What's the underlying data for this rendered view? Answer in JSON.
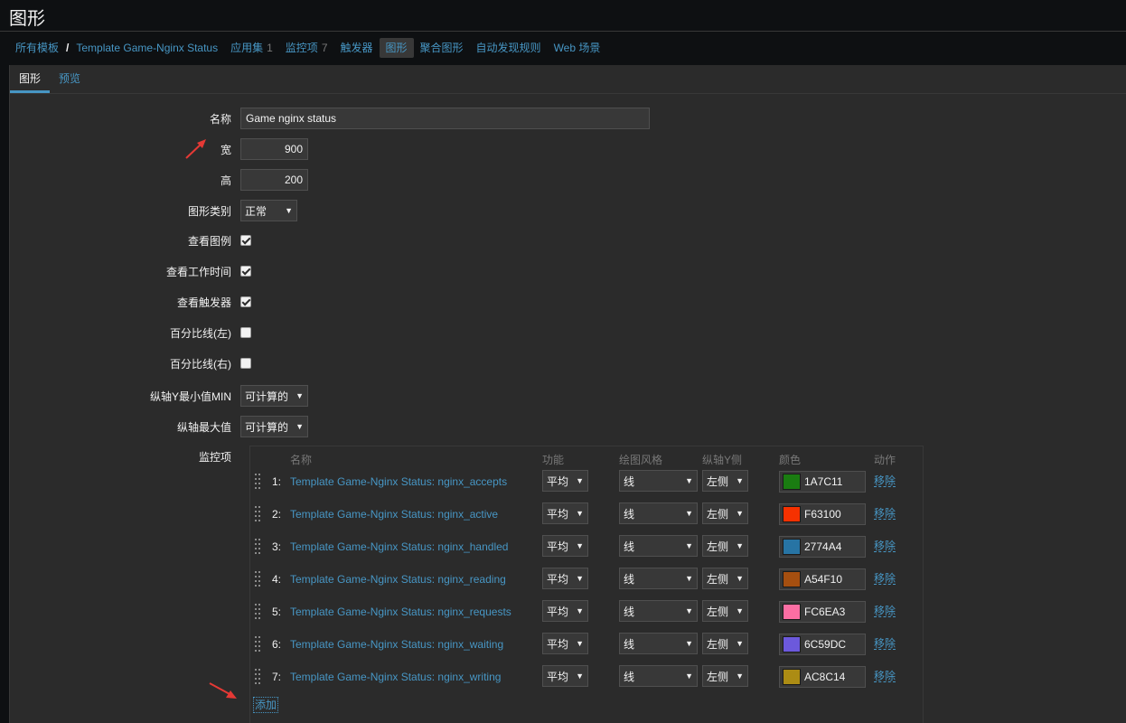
{
  "page": {
    "title": "图形"
  },
  "breadcrumbs": [
    {
      "label": "所有模板",
      "count": ""
    },
    {
      "label": "Template Game-Nginx Status",
      "count": ""
    },
    {
      "label": "应用集",
      "count": "1"
    },
    {
      "label": "监控项",
      "count": "7"
    },
    {
      "label": "触发器",
      "count": ""
    },
    {
      "label": "图形",
      "count": ""
    },
    {
      "label": "聚合图形",
      "count": ""
    },
    {
      "label": "自动发现规则",
      "count": ""
    },
    {
      "label": "Web 场景",
      "count": ""
    }
  ],
  "breadcrumb_separator": "/",
  "tabs": {
    "graph": "图形",
    "preview": "预览"
  },
  "form": {
    "name": {
      "label": "名称",
      "value": "Game nginx status"
    },
    "width": {
      "label": "宽",
      "value": "900"
    },
    "height": {
      "label": "高",
      "value": "200"
    },
    "graph_type": {
      "label": "图形类别",
      "value": "正常"
    },
    "show_legend": {
      "label": "查看图例",
      "checked": true
    },
    "show_working_time": {
      "label": "查看工作时间",
      "checked": true
    },
    "show_triggers": {
      "label": "查看触发器",
      "checked": true
    },
    "percentile_left": {
      "label": "百分比线(左)",
      "checked": false
    },
    "percentile_right": {
      "label": "百分比线(右)",
      "checked": false
    },
    "ymin": {
      "label": "纵轴Y最小值MIN",
      "value": "可计算的"
    },
    "ymax": {
      "label": "纵轴最大值",
      "value": "可计算的"
    },
    "items_label": "监控项"
  },
  "items_table": {
    "headers": {
      "name": "名称",
      "function": "功能",
      "style": "绘图风格",
      "yaxis": "纵轴Y侧",
      "color": "颜色",
      "action": "动作"
    },
    "rows": [
      {
        "index": "1:",
        "name": "Template Game-Nginx Status: nginx_accepts",
        "function": "平均",
        "style": "线",
        "yaxis": "左侧",
        "color": "1A7C11",
        "action": "移除"
      },
      {
        "index": "2:",
        "name": "Template Game-Nginx Status: nginx_active",
        "function": "平均",
        "style": "线",
        "yaxis": "左侧",
        "color": "F63100",
        "action": "移除"
      },
      {
        "index": "3:",
        "name": "Template Game-Nginx Status: nginx_handled",
        "function": "平均",
        "style": "线",
        "yaxis": "左侧",
        "color": "2774A4",
        "action": "移除"
      },
      {
        "index": "4:",
        "name": "Template Game-Nginx Status: nginx_reading",
        "function": "平均",
        "style": "线",
        "yaxis": "左侧",
        "color": "A54F10",
        "action": "移除"
      },
      {
        "index": "5:",
        "name": "Template Game-Nginx Status: nginx_requests",
        "function": "平均",
        "style": "线",
        "yaxis": "左侧",
        "color": "FC6EA3",
        "action": "移除"
      },
      {
        "index": "6:",
        "name": "Template Game-Nginx Status: nginx_waiting",
        "function": "平均",
        "style": "线",
        "yaxis": "左侧",
        "color": "6C59DC",
        "action": "移除"
      },
      {
        "index": "7:",
        "name": "Template Game-Nginx Status: nginx_writing",
        "function": "平均",
        "style": "线",
        "yaxis": "左侧",
        "color": "AC8C14",
        "action": "移除"
      }
    ],
    "add_label": "添加"
  },
  "theme": {
    "link": "#4796c4",
    "background": "#0e1012",
    "panel": "#2b2b2b",
    "annotation_arrow": "#e53935"
  }
}
